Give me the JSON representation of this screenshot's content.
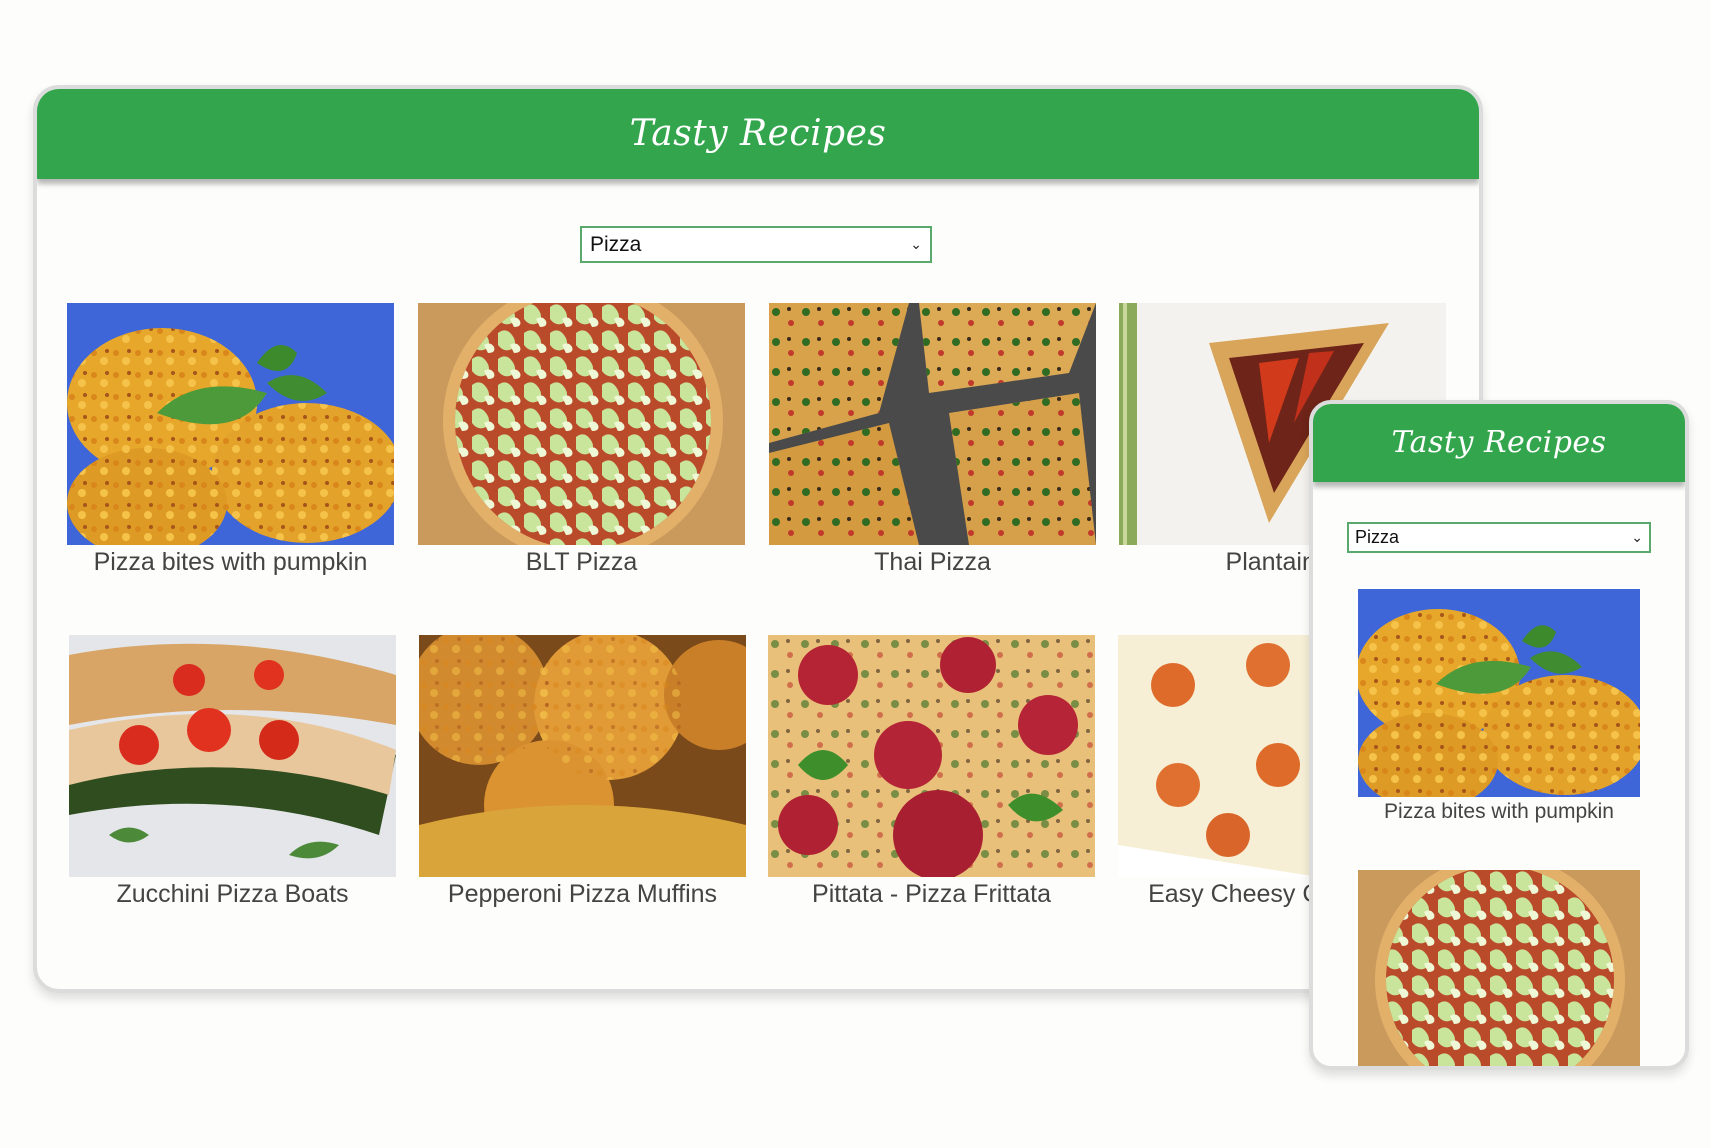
{
  "app": {
    "title": "Tasty Recipes"
  },
  "filter": {
    "selected": "Pizza",
    "chevron_icon": "chevron-down-icon"
  },
  "recipes": [
    {
      "title": "Pizza bites with pumpkin"
    },
    {
      "title": "BLT Pizza"
    },
    {
      "title": "Thai Pizza"
    },
    {
      "title": "Plantain P"
    },
    {
      "title": "Zucchini Pizza Boats"
    },
    {
      "title": "Pepperoni Pizza Muffins"
    },
    {
      "title": "Pittata - Pizza Frittata"
    },
    {
      "title": "Easy Cheesy Casserole"
    }
  ],
  "mobile": {
    "title": "Tasty Recipes",
    "selected": "Pizza",
    "recipes": [
      {
        "title": "Pizza bites with pumpkin"
      },
      {
        "title": ""
      }
    ]
  },
  "colors": {
    "header": "#33a64d",
    "select_border": "#5aa96c",
    "caption": "#444444"
  }
}
